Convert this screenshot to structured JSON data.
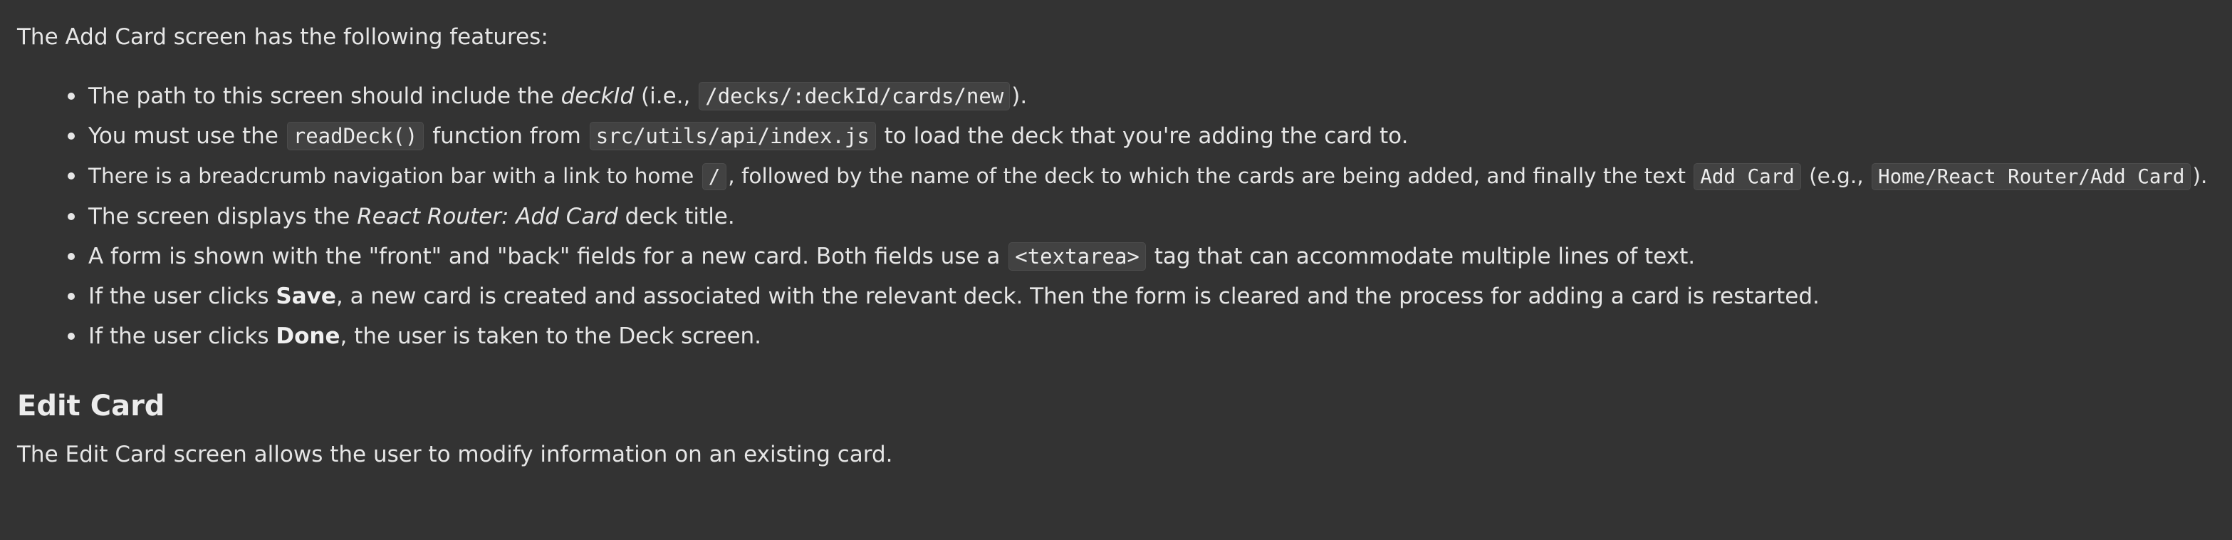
{
  "intro": "The Add Card screen has the following features:",
  "bullets": {
    "b1": {
      "t1": "The path to this screen should include the ",
      "em1": "deckId",
      "t2": " (i.e., ",
      "code1": "/decks/:deckId/cards/new",
      "t3": ")."
    },
    "b2": {
      "t1": "You must use the ",
      "code1": "readDeck()",
      "t2": " function from ",
      "code2": "src/utils/api/index.js",
      "t3": " to load the deck that you're adding the card to."
    },
    "b3": {
      "t1": "There is a breadcrumb navigation bar with a link to home ",
      "code1": "/",
      "t2": ", followed by the name of the deck to which the cards are being added, and finally the text ",
      "code2": "Add Card",
      "t3": " (e.g., ",
      "code3": "Home/React Router/Add Card",
      "t4": ")."
    },
    "b4": {
      "t1": "The screen displays the ",
      "em1": "React Router: Add Card",
      "t2": " deck title."
    },
    "b5": {
      "t1": "A form is shown with the \"front\" and \"back\" fields for a new card. Both fields use a ",
      "code1": "<textarea>",
      "t2": " tag that can accommodate multiple lines of text."
    },
    "b6": {
      "t1": "If the user clicks ",
      "strong1": "Save",
      "t2": ", a new card is created and associated with the relevant deck. Then the form is cleared and the process for adding a card is restarted."
    },
    "b7": {
      "t1": "If the user clicks ",
      "strong1": "Done",
      "t2": ", the user is taken to the Deck screen."
    }
  },
  "section": {
    "heading": "Edit Card",
    "text": "The Edit Card screen allows the user to modify information on an existing card."
  }
}
